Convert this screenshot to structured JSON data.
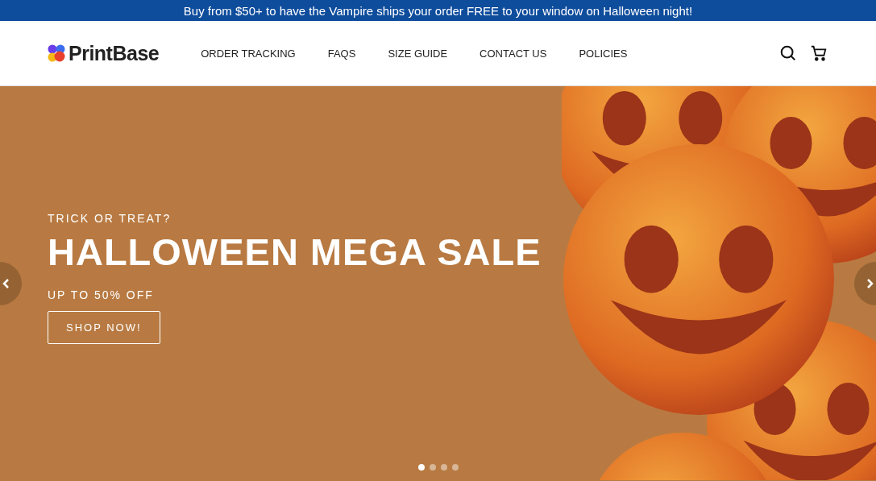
{
  "announcement": "Buy from $50+ to have the Vampire ships your order FREE to your window on Halloween night!",
  "header": {
    "logo": "PrintBase",
    "nav": [
      "ORDER TRACKING",
      "FAQS",
      "SIZE GUIDE",
      "CONTACT US",
      "POLICIES"
    ]
  },
  "hero": {
    "eyebrow": "TRICK OR TREAT?",
    "title": "HALLOWEEN MEGA SALE",
    "subtitle": "UP TO 50% OFF",
    "button": "SHOP NOW!",
    "slides": [
      {
        "selected": true
      },
      {
        "selected": false
      },
      {
        "selected": false
      },
      {
        "selected": false
      }
    ]
  }
}
